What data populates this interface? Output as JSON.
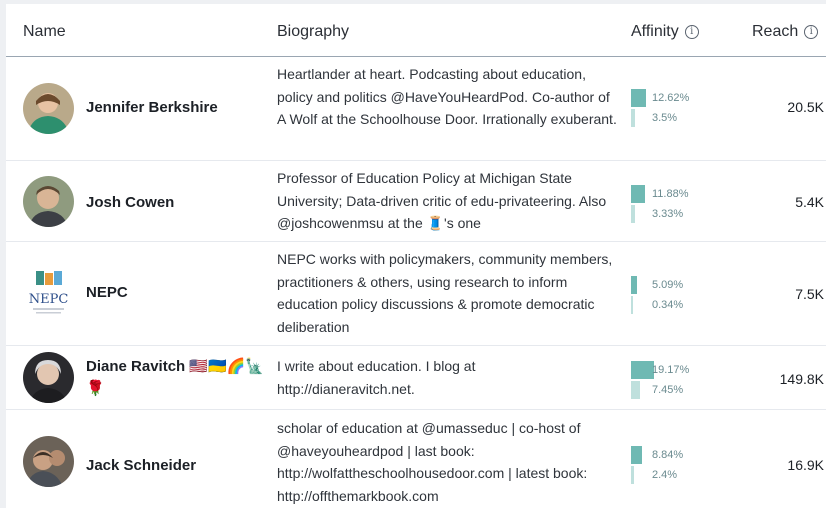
{
  "header": {
    "name_label": "Name",
    "biography_label": "Biography",
    "affinity_label": "Affinity",
    "reach_label": "Reach",
    "info_glyph": "i"
  },
  "rows": [
    {
      "name": "Jennifer Berkshire",
      "bio": "Heartlander at heart. Podcasting about education, policy and politics @HaveYouHeardPod. Co-author of A Wolf at the Schoolhouse Door. Irrationally exuberant.",
      "affinity_primary": "12.62%",
      "affinity_secondary": "3.5%",
      "primary_value": 12.62,
      "secondary_value": 3.5,
      "reach": "20.5K"
    },
    {
      "name": "Josh Cowen",
      "bio": "Professor of Education Policy at Michigan State University; Data-driven critic of edu-privateering. Also @joshcowenmsu at the 🧵's one",
      "affinity_primary": "11.88%",
      "affinity_secondary": "3.33%",
      "primary_value": 11.88,
      "secondary_value": 3.33,
      "reach": "5.4K"
    },
    {
      "name": "NEPC",
      "logo_text": "NEPC",
      "bio": "NEPC works with policymakers, community members, practitioners & others, using research to inform education policy discussions & promote democratic deliberation",
      "affinity_primary": "5.09%",
      "affinity_secondary": "0.34%",
      "primary_value": 5.09,
      "secondary_value": 0.34,
      "reach": "7.5K"
    },
    {
      "name": "Diane Ravitch 🇺🇸🇺🇦🌈🗽 🌹",
      "bio": "I write about education. I blog at http://dianeravitch.net.",
      "affinity_primary": "19.17%",
      "affinity_secondary": "7.45%",
      "primary_value": 19.17,
      "secondary_value": 7.45,
      "reach": "149.8K"
    },
    {
      "name": "Jack Schneider",
      "bio": "scholar of education at @umasseduc | co-host of @haveyouheardpod | last book: http://wolfattheschoolhousedoor.com | latest book: http://offthemarkbook.com",
      "affinity_primary": "8.84%",
      "affinity_secondary": "2.4%",
      "primary_value": 8.84,
      "secondary_value": 2.4,
      "reach": "16.9K"
    }
  ],
  "colors": {
    "primary_bar": "#6fb9b3",
    "secondary_bar": "#bfe0dd"
  },
  "icons": [
    "info-icon",
    "avatar-photo",
    "nepc-logo"
  ]
}
